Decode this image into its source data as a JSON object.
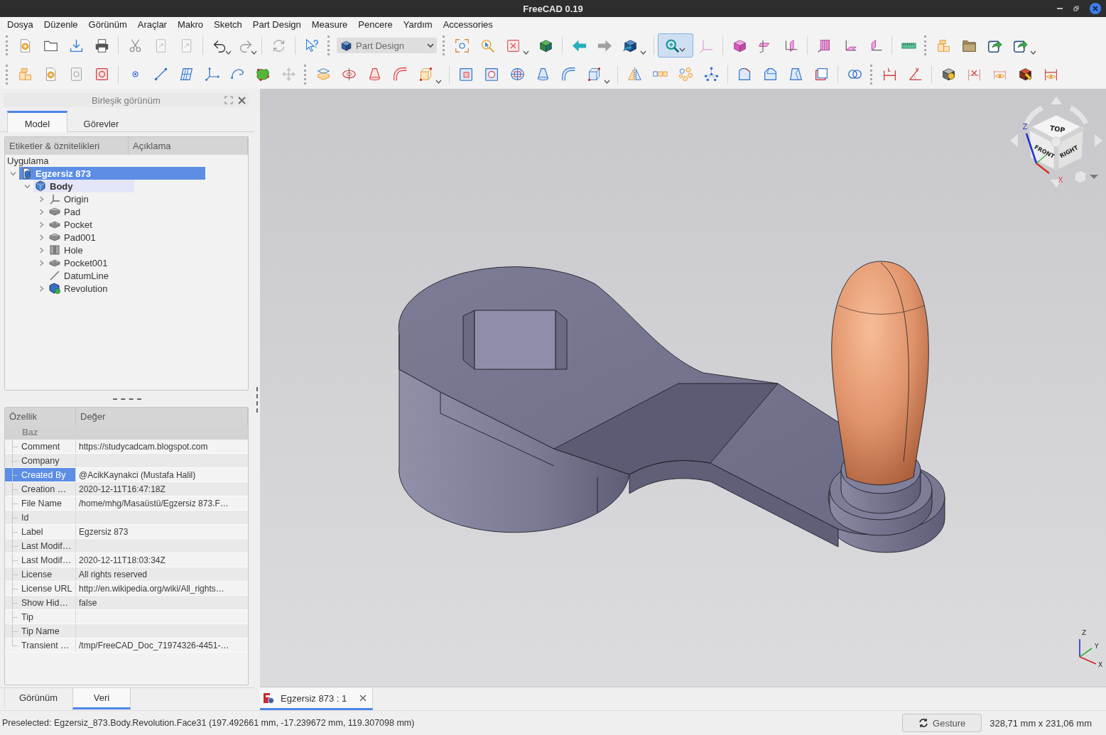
{
  "window": {
    "title": "FreeCAD 0.19"
  },
  "menu": [
    "Dosya",
    "Düzenle",
    "Görünüm",
    "Araçlar",
    "Makro",
    "Sketch",
    "Part Design",
    "Measure",
    "Pencere",
    "Yardım",
    "Accessories"
  ],
  "toolbar": {
    "workbench": "Part Design",
    "zoom_tool_pressed": true
  },
  "combo_view": {
    "title": "Birleşik görünüm",
    "tabs": [
      {
        "label": "Model",
        "selected": true
      },
      {
        "label": "Görevler",
        "selected": false
      }
    ],
    "tree": {
      "columns": [
        "Etiketler & öznitelikleri",
        "Açıklama"
      ],
      "root": "Uygulama",
      "items": [
        {
          "label": "Egzersiz 873",
          "kind": "document",
          "selected": true,
          "active": false,
          "expanded": true,
          "children": [
            {
              "label": "Body",
              "kind": "body",
              "selected": false,
              "active": true,
              "expanded": true,
              "children": [
                {
                  "label": "Origin",
                  "kind": "origin",
                  "selected": false,
                  "active": false,
                  "expanded": false
                },
                {
                  "label": "Pad",
                  "kind": "pad",
                  "selected": false,
                  "active": false,
                  "expanded": false
                },
                {
                  "label": "Pocket",
                  "kind": "pocket",
                  "selected": false,
                  "active": false,
                  "expanded": false
                },
                {
                  "label": "Pad001",
                  "kind": "pad",
                  "selected": false,
                  "active": false,
                  "expanded": false
                },
                {
                  "label": "Hole",
                  "kind": "hole",
                  "selected": false,
                  "active": false,
                  "expanded": false
                },
                {
                  "label": "Pocket001",
                  "kind": "pocket",
                  "selected": false,
                  "active": false,
                  "expanded": false
                },
                {
                  "label": "DatumLine",
                  "kind": "datum_line",
                  "selected": false,
                  "active": false
                },
                {
                  "label": "Revolution",
                  "kind": "revolution",
                  "selected": false,
                  "active": false,
                  "expanded": false
                }
              ]
            }
          ]
        }
      ]
    },
    "properties": {
      "columns": [
        "Özellik",
        "Değer"
      ],
      "group": "Baz",
      "rows": [
        {
          "name": "Comment",
          "value": "https://studycadcam.blogspot.com",
          "selected": false
        },
        {
          "name": "Company",
          "selected": false
        },
        {
          "name": "Created By",
          "value": "@AcikKaynakci (Mustafa Halil)",
          "selected": true
        },
        {
          "name": "Creation …",
          "value": "2020-12-11T16:47:18Z",
          "selected": false
        },
        {
          "name": "File Name",
          "value": "/home/mhg/Masaüstü/Egzersiz 873.F…",
          "selected": false
        },
        {
          "name": "Id",
          "selected": false
        },
        {
          "name": "Label",
          "value": "Egzersiz 873",
          "selected": false
        },
        {
          "name": "Last Modif…",
          "selected": false
        },
        {
          "name": "Last Modif…",
          "value": "2020-12-11T18:03:34Z",
          "selected": false
        },
        {
          "name": "License",
          "value": "All rights reserved",
          "selected": false
        },
        {
          "name": "License URL",
          "value": "http://en.wikipedia.org/wiki/All_rights…",
          "selected": false
        },
        {
          "name": "Show Hid…",
          "value": "false",
          "selected": false
        },
        {
          "name": "Tip",
          "selected": false
        },
        {
          "name": "Tip Name",
          "selected": false
        },
        {
          "name": "Transient …",
          "value": "/tmp/FreeCAD_Doc_71974326-4451-…",
          "selected": false
        }
      ]
    },
    "bottom_tabs": [
      {
        "label": "Görünüm",
        "selected": false
      },
      {
        "label": "Veri",
        "selected": true
      }
    ]
  },
  "viewport": {
    "nav_cube": {
      "faces": [
        "TOP",
        "FRONT",
        "RIGHT"
      ],
      "axes": [
        "Z",
        "X"
      ]
    },
    "axis_triad": [
      "Z",
      "Y",
      "X"
    ]
  },
  "document_tabs": [
    {
      "label": "Egzersiz 873 : 1",
      "selected": true
    }
  ],
  "status_bar": {
    "message": "Preselected: Egzersiz_873.Body.Revolution.Face31 (197.492661 mm, -17.239672 mm, 119.307098 mm)",
    "navigation_style": "Gesture",
    "dimensions": "328,71 mm x 231,06 mm"
  }
}
